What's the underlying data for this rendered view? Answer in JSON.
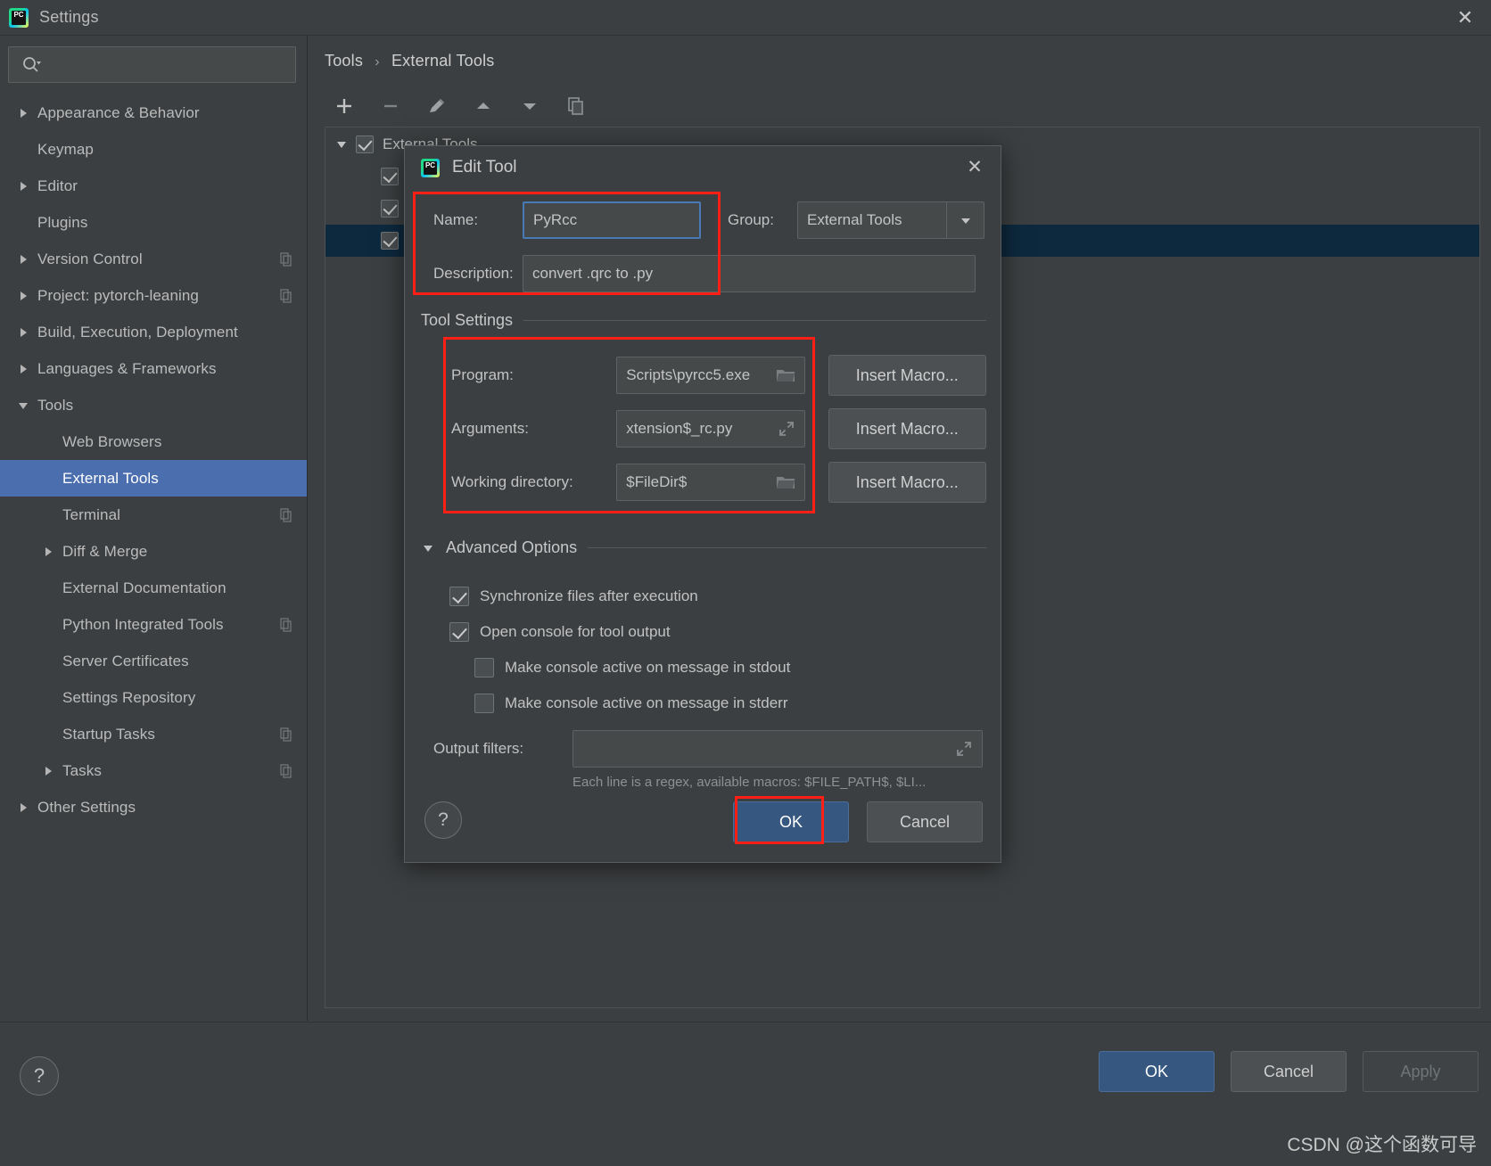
{
  "window": {
    "title": "Settings",
    "logo_text": "PC",
    "close_icon": "✕"
  },
  "search": {
    "placeholder": "",
    "value": "",
    "icon": "search-icon"
  },
  "sidebar": {
    "items": [
      {
        "label": "Appearance & Behavior",
        "arrow": "right",
        "indent": 0,
        "copy": false,
        "selected": false
      },
      {
        "label": "Keymap",
        "arrow": "none",
        "indent": 0,
        "copy": false,
        "selected": false
      },
      {
        "label": "Editor",
        "arrow": "right",
        "indent": 0,
        "copy": false,
        "selected": false
      },
      {
        "label": "Plugins",
        "arrow": "none",
        "indent": 0,
        "copy": false,
        "selected": false
      },
      {
        "label": "Version Control",
        "arrow": "right",
        "indent": 0,
        "copy": true,
        "selected": false
      },
      {
        "label": "Project: pytorch-leaning",
        "arrow": "right",
        "indent": 0,
        "copy": true,
        "selected": false
      },
      {
        "label": "Build, Execution, Deployment",
        "arrow": "right",
        "indent": 0,
        "copy": false,
        "selected": false
      },
      {
        "label": "Languages & Frameworks",
        "arrow": "right",
        "indent": 0,
        "copy": false,
        "selected": false
      },
      {
        "label": "Tools",
        "arrow": "down",
        "indent": 0,
        "copy": false,
        "selected": false
      },
      {
        "label": "Web Browsers",
        "arrow": "none",
        "indent": 1,
        "copy": false,
        "selected": false
      },
      {
        "label": "External Tools",
        "arrow": "none",
        "indent": 1,
        "copy": false,
        "selected": true
      },
      {
        "label": "Terminal",
        "arrow": "none",
        "indent": 1,
        "copy": true,
        "selected": false
      },
      {
        "label": "Diff & Merge",
        "arrow": "right",
        "indent": 1,
        "copy": false,
        "selected": false
      },
      {
        "label": "External Documentation",
        "arrow": "none",
        "indent": 1,
        "copy": false,
        "selected": false
      },
      {
        "label": "Python Integrated Tools",
        "arrow": "none",
        "indent": 1,
        "copy": true,
        "selected": false
      },
      {
        "label": "Server Certificates",
        "arrow": "none",
        "indent": 1,
        "copy": false,
        "selected": false
      },
      {
        "label": "Settings Repository",
        "arrow": "none",
        "indent": 1,
        "copy": false,
        "selected": false
      },
      {
        "label": "Startup Tasks",
        "arrow": "none",
        "indent": 1,
        "copy": true,
        "selected": false
      },
      {
        "label": "Tasks",
        "arrow": "right",
        "indent": 1,
        "copy": true,
        "selected": false
      },
      {
        "label": "Other Settings",
        "arrow": "right",
        "indent": 0,
        "copy": false,
        "selected": false
      }
    ]
  },
  "content": {
    "breadcrumb": {
      "parent": "Tools",
      "separator": "›",
      "current": "External Tools"
    },
    "toolbar": [
      {
        "name": "add-button",
        "icon": "plus-icon"
      },
      {
        "name": "remove-button",
        "icon": "minus-icon"
      },
      {
        "name": "edit-button",
        "icon": "pencil-icon"
      },
      {
        "name": "move-up-button",
        "icon": "arrow-up-icon"
      },
      {
        "name": "move-down-button",
        "icon": "arrow-down-icon"
      },
      {
        "name": "copy-button",
        "icon": "copy-icon"
      }
    ],
    "tree": {
      "root": {
        "label": "External Tools",
        "checked": true,
        "expanded": true
      },
      "children": [
        {
          "label": "",
          "checked": true,
          "selected": false
        },
        {
          "label": "",
          "checked": true,
          "selected": false
        },
        {
          "label": "",
          "checked": true,
          "selected": true
        }
      ]
    }
  },
  "dialog": {
    "title": "Edit Tool",
    "logo_text": "PC",
    "close_icon": "✕",
    "name": {
      "label": "Name:",
      "value": "PyRcc"
    },
    "group": {
      "label": "Group:",
      "value": "External Tools",
      "dropdown_icon": "chevron-down-icon"
    },
    "description": {
      "label": "Description:",
      "value": "convert .qrc to .py"
    },
    "tool_settings": {
      "legend": "Tool Settings",
      "program": {
        "label": "Program:",
        "value": "Scripts\\pyrcc5.exe",
        "browse_icon": "folder-icon",
        "macro_button": "Insert Macro..."
      },
      "arguments": {
        "label": "Arguments:",
        "value": "xtension$_rc.py",
        "expand_icon": "expand-icon",
        "macro_button": "Insert Macro..."
      },
      "working_directory": {
        "label": "Working directory:",
        "value": "$FileDir$",
        "browse_icon": "folder-icon",
        "macro_button": "Insert Macro..."
      }
    },
    "advanced": {
      "legend": "Advanced Options",
      "expanded": true,
      "options": [
        {
          "label": "Synchronize files after execution",
          "checked": true,
          "indent": 0
        },
        {
          "label": "Open console for tool output",
          "checked": true,
          "indent": 0
        },
        {
          "label": "Make console active on message in stdout",
          "checked": false,
          "indent": 1
        },
        {
          "label": "Make console active on message in stderr",
          "checked": false,
          "indent": 1
        }
      ],
      "output_filters": {
        "label": "Output filters:",
        "value": "",
        "expand_icon": "expand-icon"
      },
      "hint": "Each line is a regex, available macros: $FILE_PATH$, $LI..."
    },
    "help_icon": "?",
    "ok_label": "OK",
    "cancel_label": "Cancel"
  },
  "footer": {
    "help_icon": "?",
    "ok_label": "OK",
    "cancel_label": "Cancel",
    "apply_label": "Apply",
    "watermark": "CSDN @这个函数可导"
  },
  "colors": {
    "background": "#3c3f41",
    "panel": "#45494a",
    "selection": "#4b6eaf",
    "row_selection": "#0d293e",
    "accent_button": "#365880",
    "highlight_box": "#ff1f14",
    "text": "#bbbbbb"
  }
}
